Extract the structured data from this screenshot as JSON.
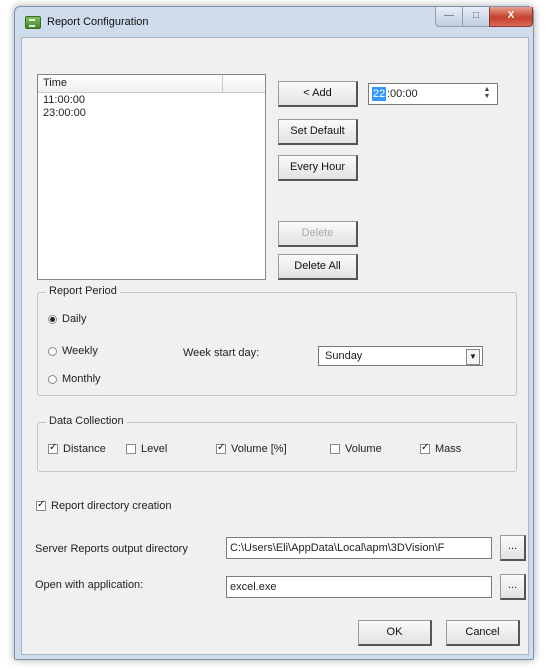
{
  "window": {
    "title": "Report Configuration",
    "controls": {
      "minimize": "—",
      "maximize": "□",
      "close": "X"
    }
  },
  "schedule": {
    "column_header": "Time",
    "times": [
      "11:00:00",
      "23:00:00"
    ],
    "time_input": {
      "highlighted": "22",
      "rest": ":00:00"
    },
    "buttons": {
      "add": "< Add",
      "set_default": "Set Default",
      "every_hour": "Every Hour",
      "delete": "Delete",
      "delete_all": "Delete All"
    }
  },
  "report_period": {
    "label": "Report Period",
    "options": [
      {
        "label": "Daily",
        "selected": true
      },
      {
        "label": "Weekly",
        "selected": false
      },
      {
        "label": "Monthly",
        "selected": false
      }
    ],
    "week_start_label": "Week start day:",
    "week_start_value": "Sunday"
  },
  "data_collection": {
    "label": "Data Collection",
    "items": [
      {
        "label": "Distance",
        "checked": true
      },
      {
        "label": "Level",
        "checked": false
      },
      {
        "label": "Volume [%]",
        "checked": true
      },
      {
        "label": "Volume",
        "checked": false
      },
      {
        "label": "Mass",
        "checked": true
      }
    ]
  },
  "report_directory_creation": {
    "label": "Report directory creation",
    "checked": true
  },
  "output_directory": {
    "label": "Server Reports output directory",
    "value": "C:\\Users\\Eli\\AppData\\Local\\apm\\3DVision\\F",
    "browse": "..."
  },
  "open_with": {
    "label": "Open with application:",
    "value": "excel.exe",
    "browse": "..."
  },
  "footer": {
    "ok": "OK",
    "cancel": "Cancel"
  }
}
